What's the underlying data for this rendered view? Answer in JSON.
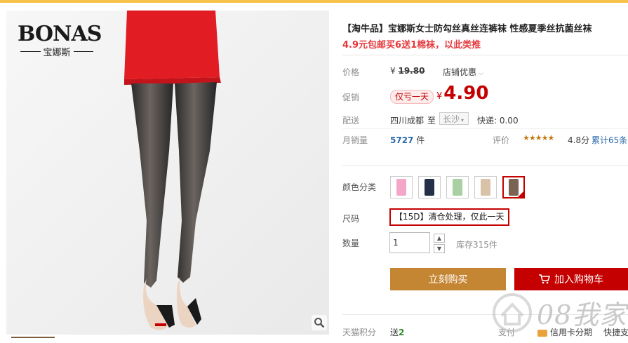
{
  "brand": {
    "name": "BONAS",
    "sub": "宝娜斯"
  },
  "product": {
    "title": "【淘牛品】宝娜斯女士防勾丝真丝连裤袜 性感夏季丝抗菌丝袜",
    "subtitle": "4.9元包邮买6送1棉袜，以此类推"
  },
  "price": {
    "label": "价格",
    "currency": "¥",
    "original": "19.80",
    "shop_discount": "店铺优惠"
  },
  "promo": {
    "label": "促销",
    "badge": "仅亏一天",
    "currency": "¥",
    "value": "4.90"
  },
  "delivery": {
    "label": "配送",
    "origin": "四川成都",
    "to": "至",
    "dest": "长沙",
    "express": "快递: 0.00"
  },
  "sales": {
    "label": "月销量",
    "count": "5727",
    "unit": "件",
    "rating_label": "评价",
    "stars": "★★★★★",
    "score": "4.8分",
    "reviews": "累计65条"
  },
  "color": {
    "label": "颜色分类",
    "swatches": [
      "#f4a6c9",
      "#233048",
      "#a9cfa2",
      "#d8c2a8",
      "#7a6352"
    ],
    "selected_index": 4
  },
  "size": {
    "label": "尺码",
    "value": "【15D】清仓处理，仅此一天"
  },
  "quantity": {
    "label": "数量",
    "value": "1",
    "stock": "库存315件"
  },
  "buttons": {
    "buy": "立刻购买",
    "cart": "加入购物车"
  },
  "footer": {
    "points_label": "天猫积分",
    "points_prefix": "送",
    "points_value": "2",
    "pay_label": "支付",
    "credit": "信用卡分期",
    "quick": "快捷支"
  },
  "watermark": {
    "text": "08我家"
  },
  "colors": {
    "accent": "#c40000",
    "buy": "#c58634",
    "topbar": "#f5c24b"
  }
}
